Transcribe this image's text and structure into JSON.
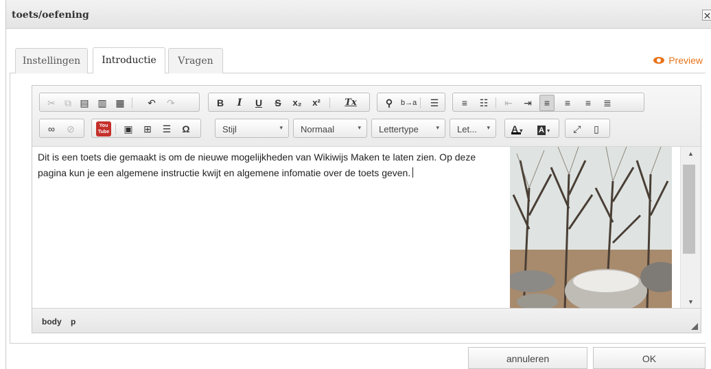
{
  "dialog": {
    "title": "toets/oefening",
    "close_glyph": "✕"
  },
  "tabs": [
    {
      "label": "Instellingen",
      "active": false
    },
    {
      "label": "Introductie",
      "active": true
    },
    {
      "label": "Vragen",
      "active": false
    }
  ],
  "preview": {
    "label": "Preview",
    "icon": "eye-icon",
    "color": "#e8731a"
  },
  "toolbar": {
    "style_combo": "Stijl",
    "format_combo": "Normaal",
    "font_combo": "Lettertype",
    "size_combo": "Let...",
    "bold": "B",
    "italic": "I",
    "underline": "U",
    "strike": "S",
    "subscript": "x₂",
    "superscript": "x²",
    "remove_format": "Tx",
    "text_color": "A",
    "bg_color": "A",
    "youtube": "You Tube",
    "special_char": "Ω",
    "search_replace": "b→a"
  },
  "editor": {
    "body_text": "Dit is een toets die gemaakt is om de nieuwe mogelijkheden van Wikiwijs Maken te laten zien. Op deze pagina kun je een algemene instructie kwijt en algemene infomatie over de toets geven.",
    "path": [
      "body",
      "p"
    ]
  },
  "footer": {
    "cancel": "annuleren",
    "ok": "OK"
  }
}
